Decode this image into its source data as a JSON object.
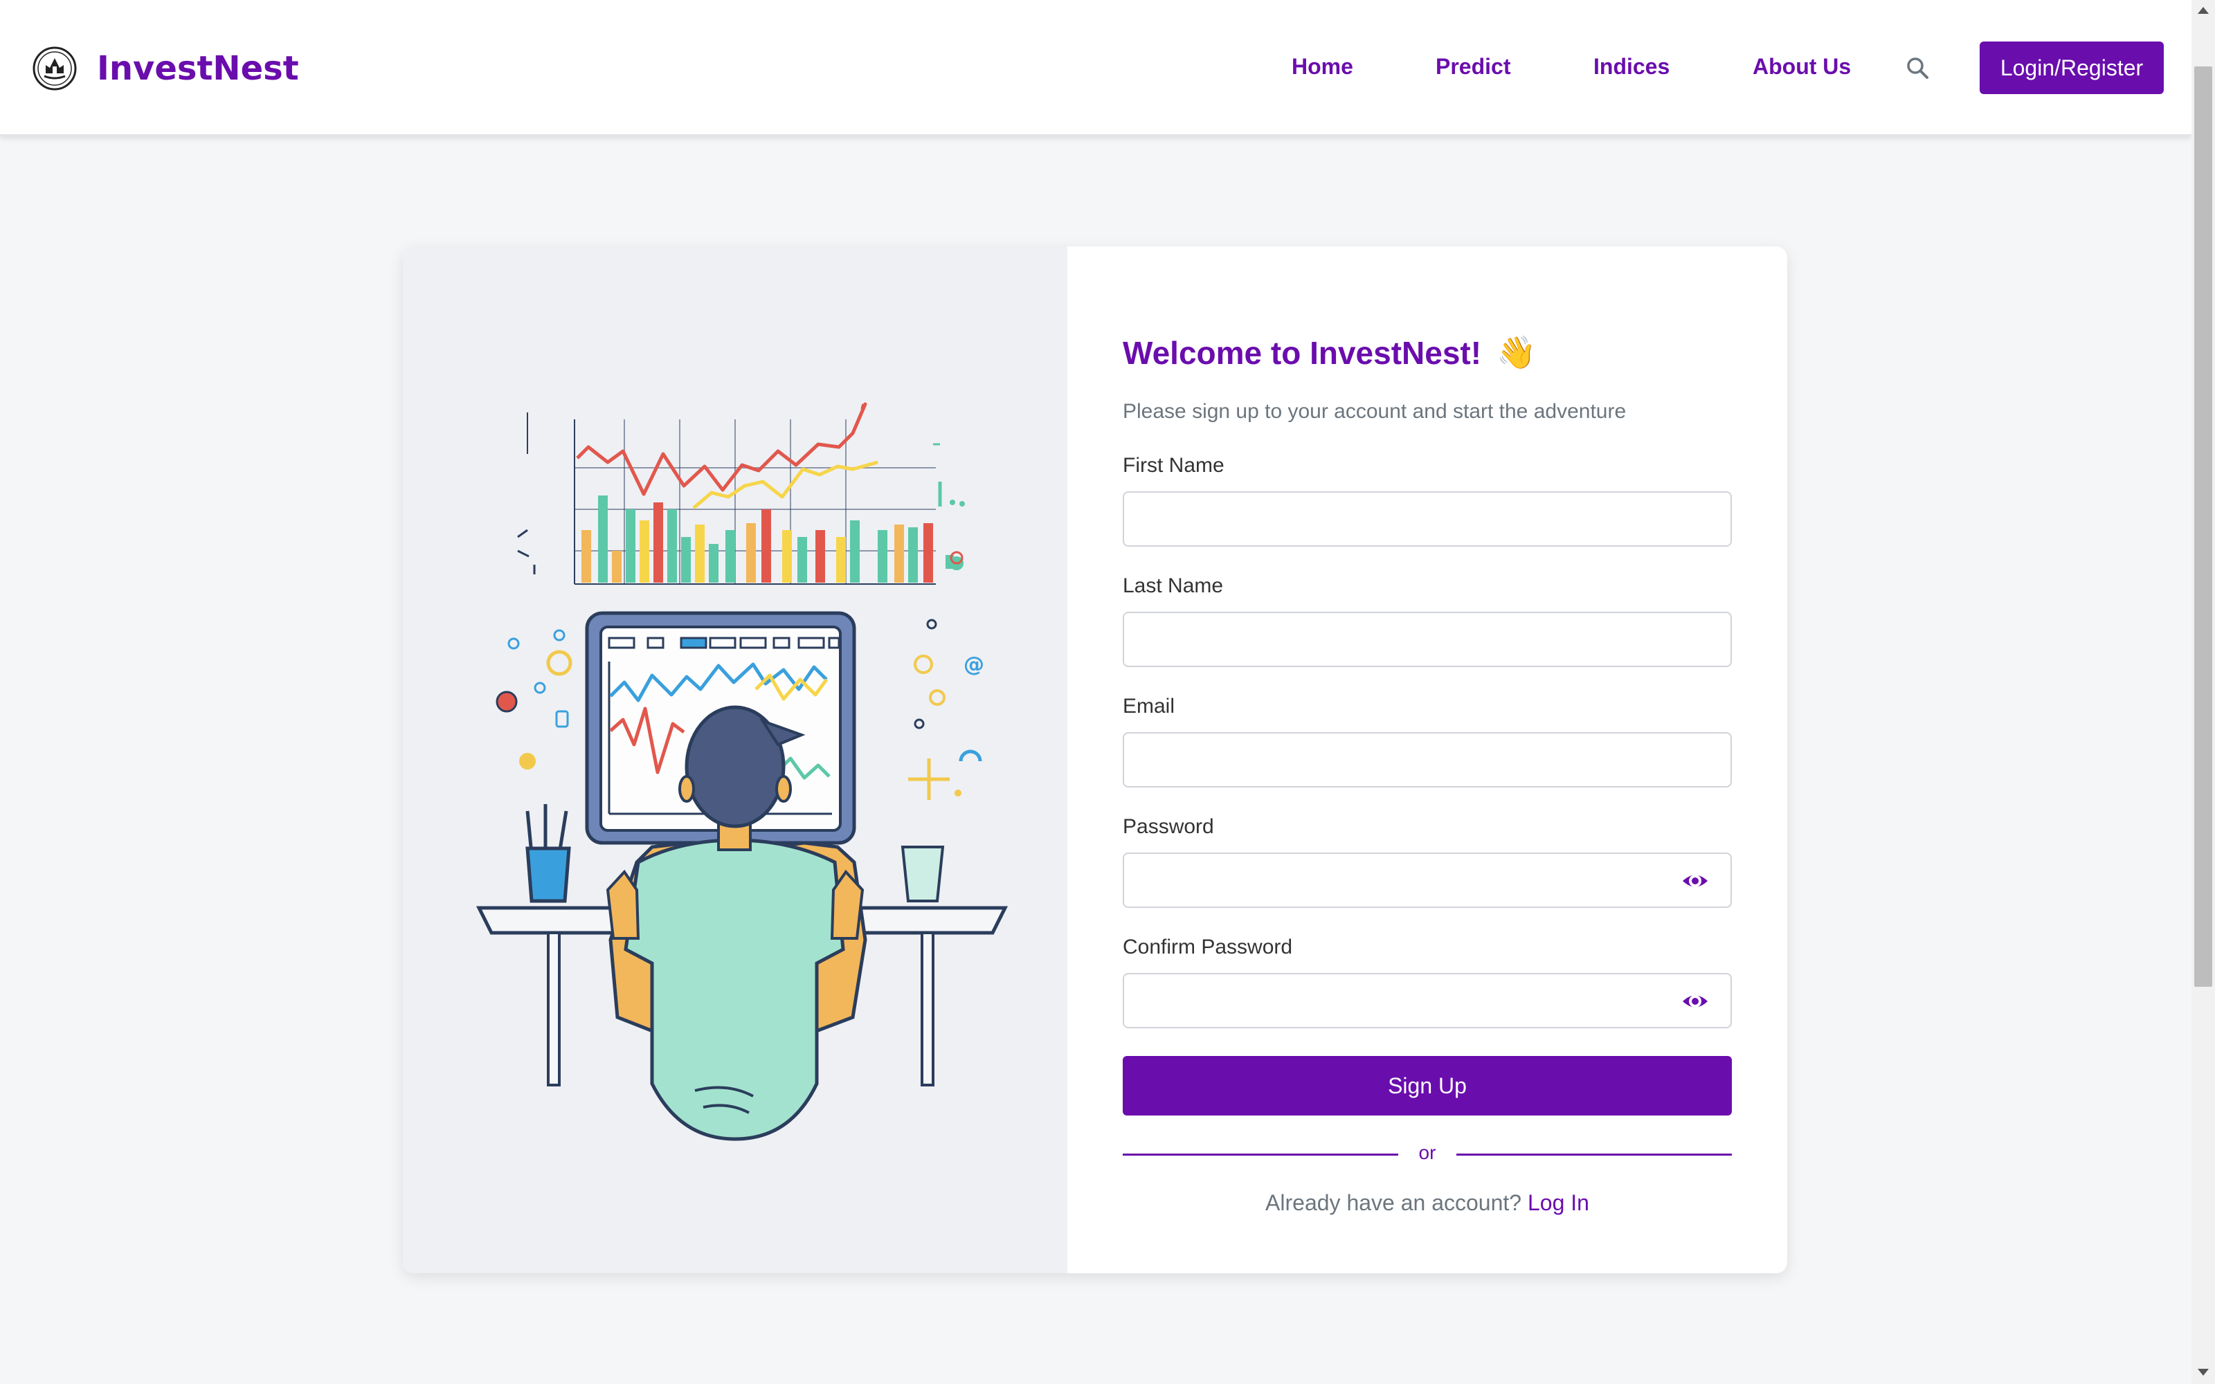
{
  "navbar": {
    "brand_name": "InvestNest",
    "links": [
      "Home",
      "Predict",
      "Indices",
      "About Us"
    ],
    "login_button": "Login/Register"
  },
  "signup": {
    "title": "Welcome to InvestNest!",
    "emoji": "👋",
    "subtitle": "Please sign up to your account and start the adventure",
    "fields": {
      "first_name": {
        "label": "First Name",
        "value": ""
      },
      "last_name": {
        "label": "Last Name",
        "value": ""
      },
      "email": {
        "label": "Email",
        "value": ""
      },
      "password": {
        "label": "Password",
        "value": ""
      },
      "confirm_password": {
        "label": "Confirm Password",
        "value": ""
      }
    },
    "submit_label": "Sign Up",
    "divider_text": "or",
    "already_text": "Already have an account?",
    "login_link": "Log In"
  },
  "colors": {
    "brand": "#6a0dad",
    "background": "#f5f6f8",
    "illustration_bg": "#eef0f4"
  },
  "icons": [
    "brand-logo-icon",
    "search-icon",
    "eye-icon",
    "waving-hand-emoji"
  ]
}
